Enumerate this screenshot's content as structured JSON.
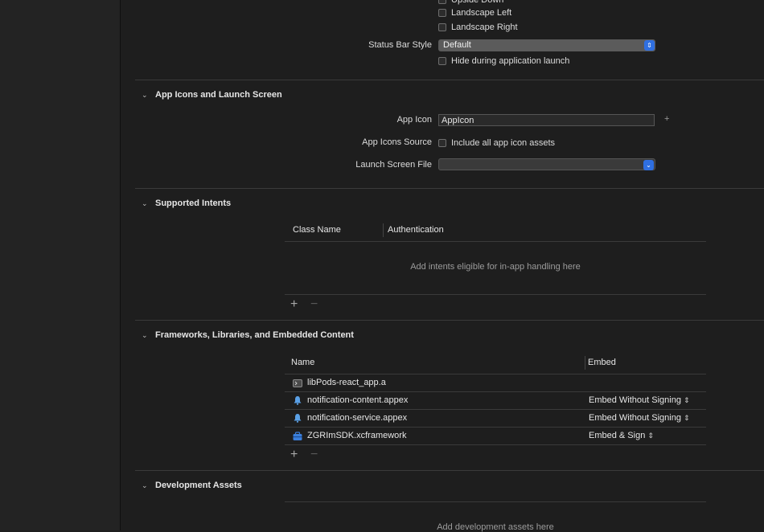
{
  "orientation": {
    "items": [
      {
        "label": "Upside Down"
      },
      {
        "label": "Landscape Left"
      },
      {
        "label": "Landscape Right"
      }
    ]
  },
  "status_bar": {
    "label": "Status Bar Style",
    "value": "Default",
    "hide_label": "Hide during application launch"
  },
  "app_icons": {
    "title": "App Icons and Launch Screen",
    "app_icon_label": "App Icon",
    "app_icon_value": "AppIcon",
    "icons_source_label": "App Icons Source",
    "icons_source_checkbox": "Include all app icon assets",
    "launch_label": "Launch Screen File",
    "launch_value": ""
  },
  "intents": {
    "title": "Supported Intents",
    "col_class": "Class Name",
    "col_auth": "Authentication",
    "placeholder": "Add intents eligible for in-app handling here"
  },
  "frameworks": {
    "title": "Frameworks, Libraries, and Embedded Content",
    "col_name": "Name",
    "col_embed": "Embed",
    "rows": [
      {
        "name": "libPods-react_app.a",
        "embed": ""
      },
      {
        "name": "notification-content.appex",
        "embed": "Embed Without Signing"
      },
      {
        "name": "notification-service.appex",
        "embed": "Embed Without Signing"
      },
      {
        "name": "ZGRImSDK.xcframework",
        "embed": "Embed & Sign"
      }
    ]
  },
  "dev_assets": {
    "title": "Development Assets",
    "placeholder": "Add development assets here"
  }
}
